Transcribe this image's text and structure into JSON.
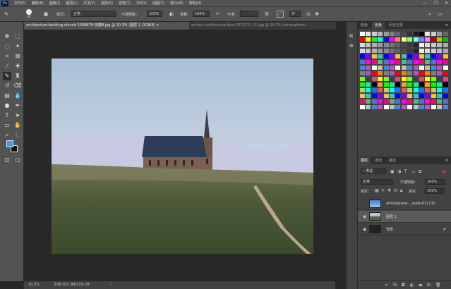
{
  "app": {
    "logo": "Ps"
  },
  "menu": [
    "文件(F)",
    "编辑(E)",
    "图像(I)",
    "图层(L)",
    "文字(Y)",
    "选择(S)",
    "滤镜(T)",
    "3D(D)",
    "视图(V)",
    "窗口(W)",
    "帮助(H)"
  ],
  "window_controls": [
    "—",
    "❐",
    "✕"
  ],
  "options": {
    "brush_size": "30",
    "mode_label": "模式：",
    "mode_value": "正常",
    "opacity_label": "不透明度：",
    "opacity_value": "100%",
    "flow_label": "流量：",
    "flow_value": "100%",
    "smooth_label": "平滑：",
    "smooth_value": "",
    "angle_value": "0°"
  },
  "tabs": [
    {
      "label": "architecture-building-church-2308878-快捷B.jpg @ 10.3% (图层 1, RGB/8) ×",
      "active": true
    },
    {
      "label": "arches-architecture-blue-2075231 (2).jpg @ 16.7% (atmosphere…",
      "active": false
    }
  ],
  "status": {
    "zoom": "10.3%",
    "doc": "文档:107.3M/379.1M"
  },
  "swatch_panel": {
    "tabs": [
      "颜色",
      "色板",
      "历史记录"
    ],
    "active": 1
  },
  "layers_panel": {
    "tabs": [
      "图层",
      "通道",
      "路径"
    ],
    "active": 0,
    "kind_label": "类型",
    "blend_mode": "正常",
    "opacity_label": "不透明度：",
    "opacity_value": "100%",
    "lock_label": "锁定：",
    "fill_label": "填充：",
    "fill_value": "100%",
    "layers": [
      {
        "name": "atmosphere-...oude-612110",
        "visible": false,
        "selected": false,
        "thumb": "sky"
      },
      {
        "name": "图层 1",
        "visible": true,
        "selected": true,
        "thumb": "church"
      },
      {
        "name": "背景",
        "visible": true,
        "selected": false,
        "thumb": "bg",
        "locked": true
      }
    ]
  },
  "colors": {
    "foreground": "#2ea6e0",
    "background": "#111111",
    "accent": "#2ea6e0"
  }
}
